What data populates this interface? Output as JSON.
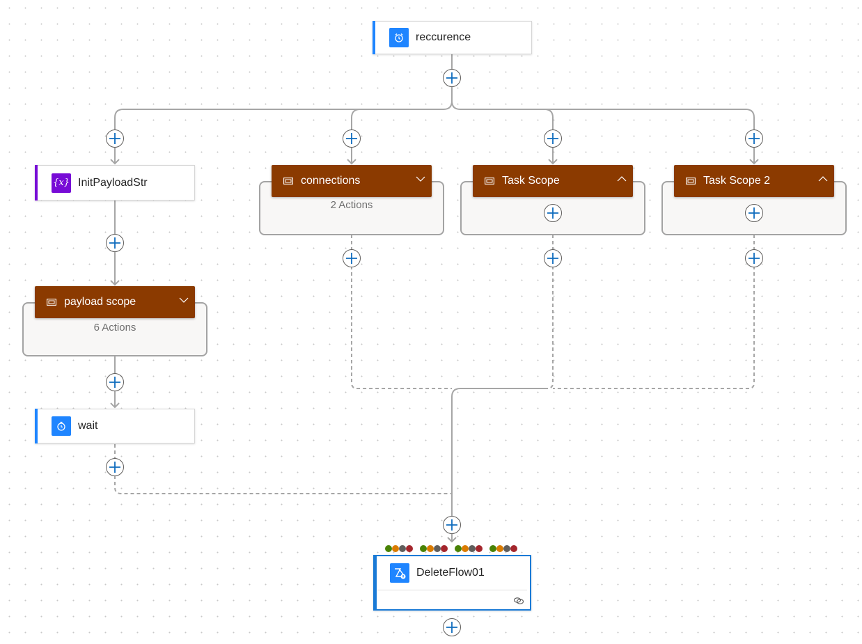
{
  "canvas": {
    "colors": {
      "trigger_accent": "#1f85ff",
      "variable_accent": "#770bd6",
      "scope_header": "#8b3a00",
      "selected_border": "#1a7ad6",
      "connector": "#a6a6a6",
      "add_plus": "#0f6cbd"
    }
  },
  "nodes": {
    "recurrence": {
      "label": "reccurence",
      "icon": "alarm-clock-icon"
    },
    "init_payload": {
      "label": "InitPayloadStr",
      "icon": "variable-icon"
    },
    "payload_scope": {
      "label": "payload scope",
      "count_text": "6 Actions",
      "state": "collapsed",
      "icon": "scope-icon"
    },
    "wait": {
      "label": "wait",
      "icon": "stopwatch-icon"
    },
    "connections": {
      "label": "connections",
      "count_text": "2 Actions",
      "state": "collapsed",
      "icon": "scope-icon"
    },
    "task_scope": {
      "label": "Task Scope",
      "state": "expanded",
      "icon": "scope-icon"
    },
    "task_scope_2": {
      "label": "Task Scope 2",
      "state": "expanded",
      "icon": "scope-icon"
    },
    "delete_flow": {
      "label": "DeleteFlow01",
      "icon": "delete-flow-icon",
      "selected": true,
      "run_after_status_groups": [
        [
          "succeeded",
          "timed-out",
          "skipped",
          "failed"
        ],
        [
          "succeeded",
          "timed-out",
          "skipped",
          "failed"
        ],
        [
          "succeeded",
          "timed-out",
          "skipped",
          "failed"
        ],
        [
          "succeeded",
          "timed-out",
          "skipped",
          "failed"
        ]
      ],
      "status_colors": {
        "succeeded": "#498205",
        "timed-out": "#da7b00",
        "skipped": "#605e5c",
        "failed": "#a4262c"
      }
    }
  }
}
